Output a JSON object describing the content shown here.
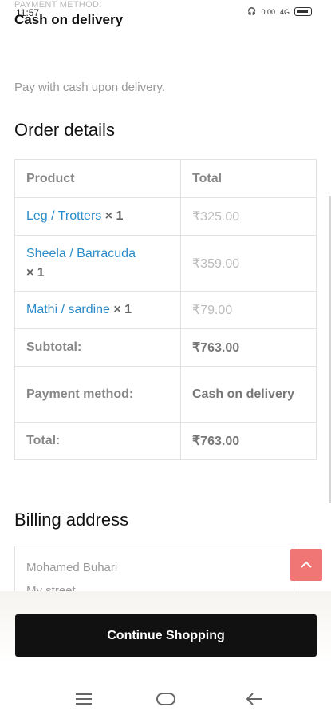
{
  "status_bar": {
    "time": "11:57",
    "left_icons": "4G",
    "network_speed": "0.00",
    "network_type": "4G",
    "battery": "85"
  },
  "payment": {
    "label": "PAYMENT METHOD:",
    "title": "Cash on delivery",
    "description": "Pay with cash upon delivery."
  },
  "order_details": {
    "heading": "Order details",
    "headers": {
      "product": "Product",
      "total": "Total"
    },
    "items": [
      {
        "name": "Leg / Trotters",
        "qty": "× 1",
        "price": "₹325.00"
      },
      {
        "name": "Sheela / Barracuda",
        "qty": "× 1",
        "price": "₹359.00"
      },
      {
        "name": "Mathi / sardine",
        "qty": "× 1",
        "price": "₹79.00"
      }
    ],
    "subtotal_label": "Subtotal:",
    "subtotal_value": "₹763.00",
    "payment_label": "Payment method:",
    "payment_value": "Cash on delivery",
    "total_label": "Total:",
    "total_value": "₹763.00"
  },
  "billing": {
    "heading": "Billing address",
    "lines": [
      "Mohamed Buhari",
      "My street"
    ]
  },
  "continue_label": "Continue Shopping",
  "colors": {
    "accent_link": "#2a8bc8",
    "scroll_top": "#f07676",
    "button": "#111111"
  }
}
